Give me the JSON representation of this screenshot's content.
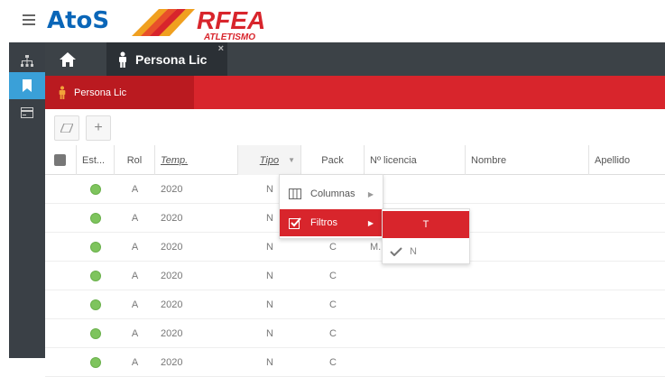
{
  "brand": {
    "name": "AtoS",
    "logo_text_top": "RFEA",
    "logo_text_bottom": "ATLETISMO"
  },
  "header": {
    "tab_title": "Persona Lic",
    "close_glyph": "×"
  },
  "subheader": {
    "tab_title": "Persona Lic"
  },
  "sidebar": {
    "items": [
      {
        "icon": "sitemap-icon"
      },
      {
        "icon": "bookmark-icon",
        "active": true
      },
      {
        "icon": "card-icon"
      }
    ]
  },
  "toolbar": {
    "eraser": "eraser-icon",
    "add_label": "+"
  },
  "grid": {
    "columns": [
      "Est...",
      "Rol",
      "Temp.",
      "Tipo",
      "Pack",
      "Nº licencia",
      "Nombre",
      "Apellido"
    ],
    "rows": [
      {
        "rol": "A",
        "temp": "2020",
        "tipo": "N",
        "pack": "",
        "lic": ""
      },
      {
        "rol": "A",
        "temp": "2020",
        "tipo": "N",
        "pack": "",
        "lic": ""
      },
      {
        "rol": "A",
        "temp": "2020",
        "tipo": "N",
        "pack": "C",
        "lic": "M."
      },
      {
        "rol": "A",
        "temp": "2020",
        "tipo": "N",
        "pack": "C",
        "lic": ""
      },
      {
        "rol": "A",
        "temp": "2020",
        "tipo": "N",
        "pack": "C",
        "lic": ""
      },
      {
        "rol": "A",
        "temp": "2020",
        "tipo": "N",
        "pack": "C",
        "lic": ""
      },
      {
        "rol": "A",
        "temp": "2020",
        "tipo": "N",
        "pack": "C",
        "lic": ""
      }
    ]
  },
  "column_menu": {
    "items": [
      {
        "label": "Columnas",
        "icon": "columns-icon"
      },
      {
        "label": "Filtros",
        "icon": "checkbox-icon",
        "active": true
      }
    ]
  },
  "filter_submenu": {
    "items": [
      {
        "label": "T",
        "active": true
      },
      {
        "label": "N",
        "checked": true
      }
    ]
  },
  "colors": {
    "accent_red": "#d8252c",
    "dark": "#3c4247",
    "sidebar_active": "#3aa0d8",
    "status_green": "#7ec45d"
  }
}
